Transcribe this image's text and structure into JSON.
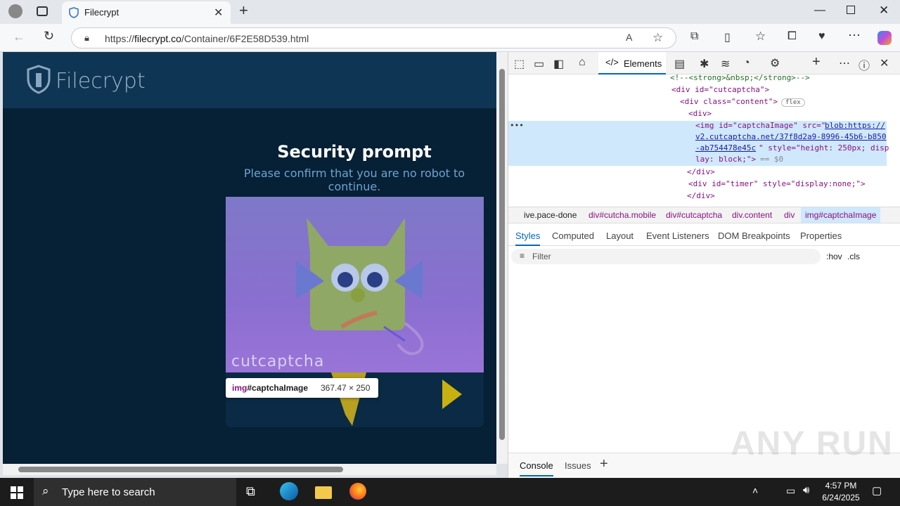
{
  "browser": {
    "tab_title": "Filecrypt",
    "url_prefix": "https://",
    "url_host": "filecrypt.co",
    "url_path": "/Container/6F2E58D539.html"
  },
  "page": {
    "logo": "Filecrypt",
    "title": "Security prompt",
    "subtitle": "Please confirm that you are no robot to continue.",
    "captcha_brand": "cutcaptcha",
    "tooltip_tag": "img",
    "tooltip_id": "#captchaImage",
    "tooltip_size": "367.47 × 250"
  },
  "devtools": {
    "active_tab": "Elements",
    "lines": [
      "<!--<strong>&nbsp;</strong>-->",
      "<div id=\"cutcaptcha\">",
      "<div class=\"content\">",
      "flex",
      "<div>",
      "<img id=\"captchaImage\" src=\"",
      "blob:https://",
      "v2.cutcaptcha.net/37f8d2a9-8996-45b6-b850",
      "-ab754478e45c",
      "\" style=\"height: 250px; disp",
      "lay: block;\">",
      "== $0",
      "</div>",
      "<div id=\"timer\" style=\"display:none;\">",
      "</div>"
    ],
    "breadcrumbs": [
      "ive.pace-done",
      "div#cutcha.mobile",
      "div#cutcaptcha",
      "div.content",
      "div",
      "img#captchaImage"
    ],
    "panel_tabs": [
      "Styles",
      "Computed",
      "Layout",
      "Event Listeners",
      "DOM Breakpoints",
      "Properties"
    ],
    "filter_placeholder": "Filter",
    "hov": ":hov",
    "cls": ".cls",
    "drawer_tabs": [
      "Console",
      "Issues"
    ]
  },
  "watermark": "ANY RUN",
  "taskbar": {
    "search_placeholder": "Type here to search",
    "time": "4:57 PM",
    "date": "6/24/2025"
  }
}
